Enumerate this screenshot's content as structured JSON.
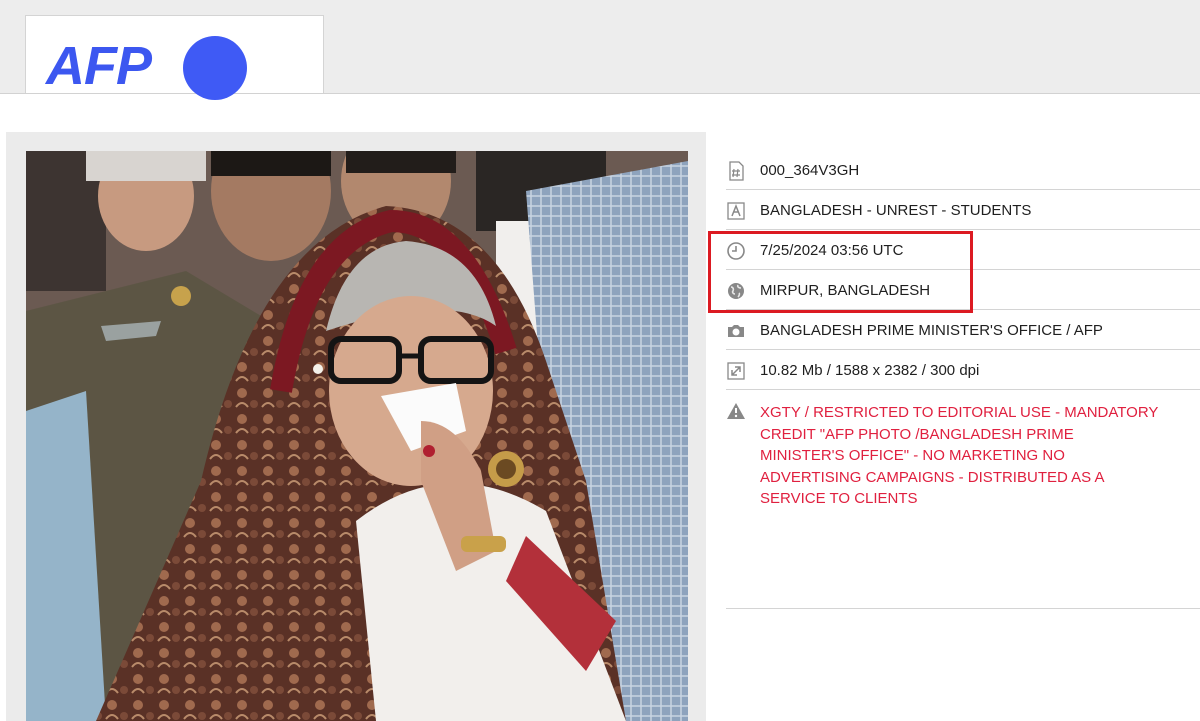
{
  "logo": {
    "text": "AFP",
    "color": "#3c57f0"
  },
  "meta": [
    {
      "icon": "hash-icon",
      "text": "000_364V3GH"
    },
    {
      "icon": "caption-icon",
      "text": "BANGLADESH - UNREST - STUDENTS"
    },
    {
      "icon": "clock-icon",
      "text": "7/25/2024 03:56 UTC"
    },
    {
      "icon": "globe-icon",
      "text": "MIRPUR, BANGLADESH"
    },
    {
      "icon": "camera-icon",
      "text": "BANGLADESH PRIME MINISTER'S OFFICE / AFP"
    },
    {
      "icon": "resize-icon",
      "text": "10.82 Mb / 1588 x 2382 / 300 dpi"
    }
  ],
  "warning": {
    "icon": "warning-icon",
    "text": "XGTY / RESTRICTED TO EDITORIAL USE - MANDATORY CREDIT \"AFP PHOTO /BANGLADESH PRIME MINISTER'S OFFICE\" - NO MARKETING NO ADVERTISING CAMPAIGNS - DISTRIBUTED AS A SERVICE TO CLIENTS",
    "color": "#e0203f"
  },
  "highlight_color": "#dc1a22"
}
